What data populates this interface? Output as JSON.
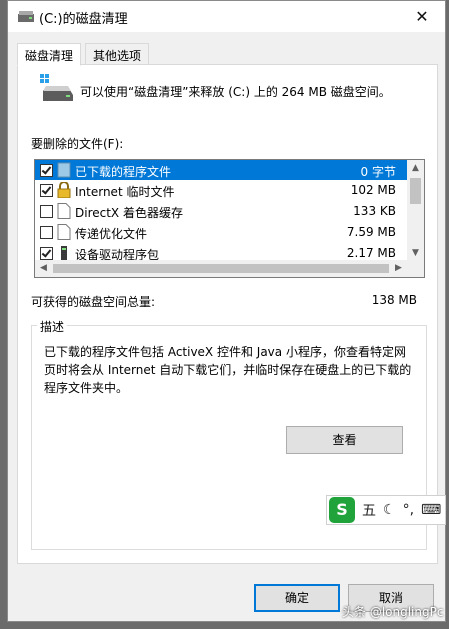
{
  "window": {
    "title": "(C:)的磁盘清理",
    "close_glyph": "✕"
  },
  "tabs": [
    {
      "label": "磁盘清理",
      "active": true
    },
    {
      "label": "其他选项",
      "active": false
    }
  ],
  "intro_text": "可以使用“磁盘清理”来释放  (C:) 上的 264 MB 磁盘空间。",
  "files_label": "要删除的文件(F):",
  "files": [
    {
      "name": "已下载的程序文件",
      "size": "0 字节",
      "checked": true,
      "selected": true,
      "icon": "folder-icon"
    },
    {
      "name": "Internet 临时文件",
      "size": "102 MB",
      "checked": true,
      "selected": false,
      "icon": "lock-icon"
    },
    {
      "name": "DirectX 着色器缓存",
      "size": "133 KB",
      "checked": false,
      "selected": false,
      "icon": "file-icon"
    },
    {
      "name": "传递优化文件",
      "size": "7.59 MB",
      "checked": false,
      "selected": false,
      "icon": "file-icon"
    },
    {
      "name": "设备驱动程序包",
      "size": "2.17 MB",
      "checked": true,
      "selected": false,
      "icon": "driver-icon"
    }
  ],
  "total": {
    "label": "可获得的磁盘空间总量:",
    "value": "138 MB"
  },
  "description": {
    "legend": "描述",
    "text": "已下载的程序文件包括 ActiveX 控件和 Java 小程序，你查看特定网页时将会从 Internet 自动下载它们，并临时保存在硬盘上的已下载的程序文件夹中。"
  },
  "view_button_label": "查看",
  "ok_label": "确定",
  "cancel_label": "取消",
  "ime": {
    "logo": "S",
    "mode": "五",
    "moon": "☾",
    "punct": "°,",
    "keyboard": "⌨"
  },
  "watermark": "头条 @longlingPc",
  "colors": {
    "selection": "#0078d7",
    "ime_green": "#1fa33a"
  }
}
